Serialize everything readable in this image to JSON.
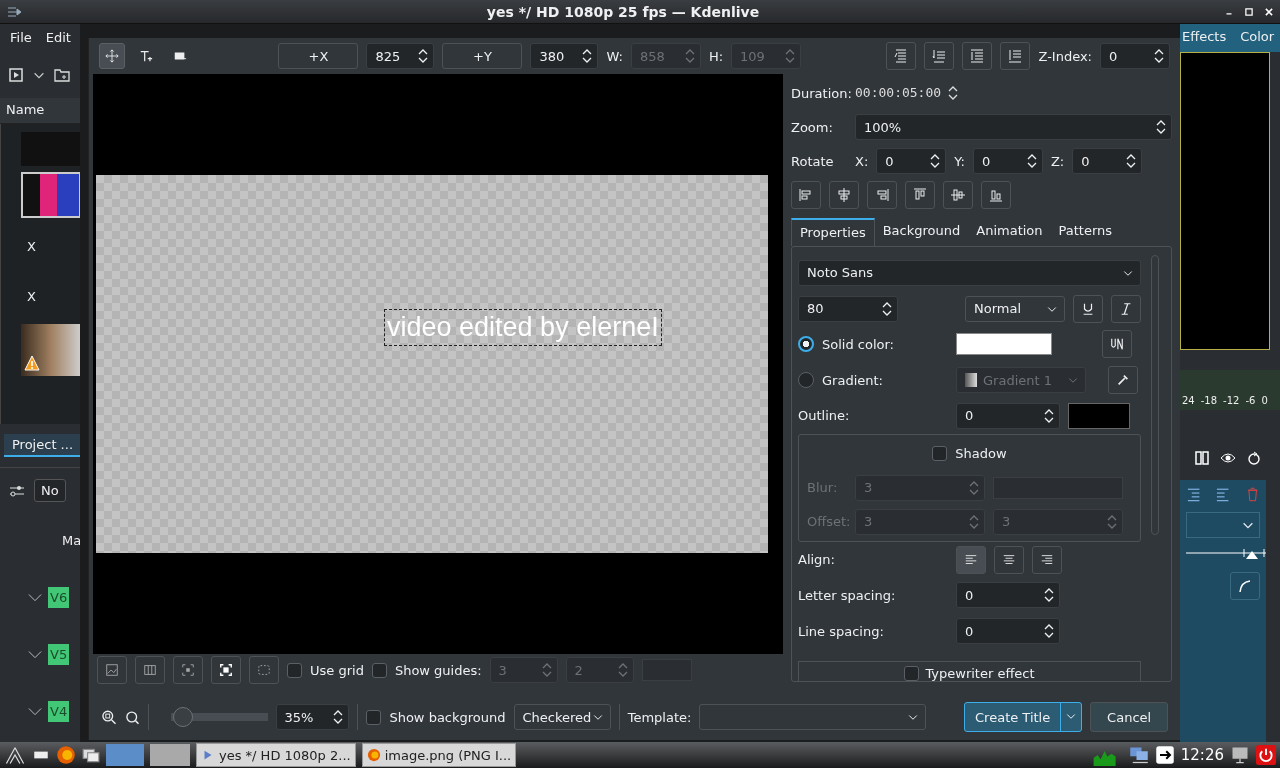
{
  "window": {
    "title": "yes */ HD 1080p 25 fps — Kdenlive"
  },
  "menu": [
    {
      "label": "File"
    },
    {
      "label": "Edit"
    }
  ],
  "bin": {
    "column": "Name",
    "items": [
      {
        "kind": "image",
        "selected": false
      },
      {
        "kind": "image",
        "selected": true
      },
      {
        "kind": "text",
        "label": "X",
        "selected": false
      },
      {
        "kind": "text",
        "label": "X",
        "selected": false
      },
      {
        "kind": "photo",
        "warning": true,
        "selected": false
      }
    ]
  },
  "project_tab": {
    "label": "Project ..."
  },
  "timeline": {
    "filter_label": "No",
    "header": "Ma",
    "tracks": [
      {
        "label": "V6"
      },
      {
        "label": "V5"
      },
      {
        "label": "V4"
      }
    ]
  },
  "side": {
    "tabs": [
      {
        "label": "Effects"
      },
      {
        "label": "Color"
      }
    ],
    "meter_ticks": [
      "24",
      "-18",
      "-12",
      "-6",
      "0"
    ]
  },
  "title_dialog": {
    "tools": [
      {
        "kind": "select",
        "selected": true
      },
      {
        "kind": "text",
        "selected": false
      },
      {
        "kind": "rect",
        "selected": false
      }
    ],
    "x_button": "+X",
    "x": {
      "value": "825"
    },
    "y_button": "+Y",
    "y": {
      "value": "380"
    },
    "w_label": "W:",
    "w": {
      "value": "858",
      "disabled": true
    },
    "h_label": "H:",
    "h": {
      "value": "109",
      "disabled": true
    },
    "z_label": "Z-Index:",
    "z": {
      "value": "0"
    },
    "canvas_text": "video edited by elerneI",
    "duration_label": "Duration:",
    "duration": "00:00:05:00",
    "zoom_label": "Zoom:",
    "zoom": "100%",
    "rotate_label": "Rotate",
    "rotate": [
      {
        "label": "X:",
        "value": "0"
      },
      {
        "label": "Y:",
        "value": "0"
      },
      {
        "label": "Z:",
        "value": "0"
      }
    ],
    "tabs": [
      {
        "label": "Properties",
        "selected": true
      },
      {
        "label": "Background",
        "selected": false
      },
      {
        "label": "Animation",
        "selected": false
      },
      {
        "label": "Patterns",
        "selected": false
      }
    ],
    "font": "Noto Sans",
    "size": {
      "value": "80"
    },
    "weight": "Normal",
    "fill": [
      {
        "label": "Solid color:",
        "selected": true
      },
      {
        "label": "Gradient:",
        "selected": false
      }
    ],
    "gradient": {
      "value": "Gradient 1",
      "disabled": true
    },
    "outline_label": "Outline:",
    "outline": {
      "value": "0"
    },
    "shadow": {
      "label": "Shadow",
      "checked": false
    },
    "blur_label": "Blur:",
    "blur": {
      "value": "3",
      "disabled": true
    },
    "offset_label": "Offset:",
    "offset_x": {
      "value": "3",
      "disabled": true
    },
    "offset_y": {
      "value": "3",
      "disabled": true
    },
    "align_label": "Align:",
    "align": [
      {
        "selected": true
      },
      {
        "selected": false
      },
      {
        "selected": false
      }
    ],
    "letter_label": "Letter spacing:",
    "letter": {
      "value": "0"
    },
    "line_label": "Line spacing:",
    "line": {
      "value": "0"
    },
    "typewriter": {
      "label": "Typewriter effect",
      "checked": false
    },
    "use_grid": {
      "label": "Use grid",
      "checked": false
    },
    "show_guides": {
      "label": "Show guides:",
      "checked": false
    },
    "guides_x": {
      "value": "3",
      "disabled": true
    },
    "guides_y": {
      "value": "2",
      "disabled": true
    },
    "view_zoom": {
      "level": 0.03,
      "value": "35%"
    },
    "show_background": {
      "label": "Show background",
      "checked": false
    },
    "background_mode": "Checkered",
    "template_label": "Template:",
    "create": "Create Title",
    "cancel": "Cancel"
  },
  "taskbar": {
    "tasks": [
      {
        "label": "yes */ HD 1080p 2..."
      },
      {
        "label": "image.png (PNG I..."
      }
    ],
    "clock": "12:26"
  }
}
